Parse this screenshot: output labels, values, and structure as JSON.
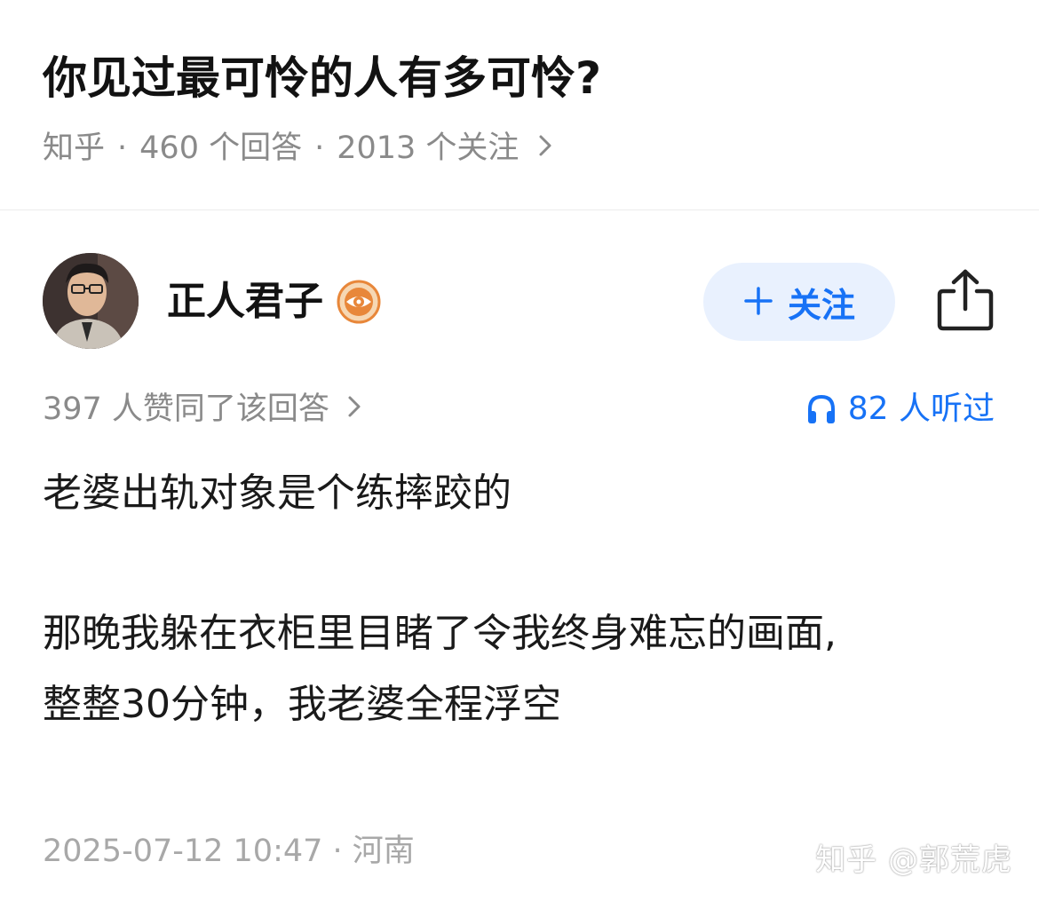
{
  "question": {
    "title": "你见过最可怜的人有多可怜?",
    "source": "知乎",
    "answers_count": "460 个回答",
    "followers_count": "2013 个关注",
    "separator": "·"
  },
  "answer": {
    "author": {
      "name": "正人君子",
      "avatar": "avatar-photo",
      "badge_icon": "eye-badge-icon"
    },
    "follow_button": {
      "icon": "plus-icon",
      "label": "关注"
    },
    "share_icon": "share-icon",
    "upvote_text": "397 人赞同了该回答",
    "listen": {
      "icon": "headphones-icon",
      "text": "82 人听过"
    },
    "paragraphs": [
      "老婆出轨对象是个练摔跤的",
      "那晚我躲在衣柜里目睹了令我终身难忘的画面,",
      "整整30分钟，我老婆全程浮空"
    ],
    "timestamp": "2025-07-12 10:47 · 河南"
  },
  "watermark": "知乎 @郭荒虎",
  "colors": {
    "accent": "#1772f6",
    "follow_bg": "#e9f1fe",
    "meta_text": "#8a8a8a",
    "badge": "#e8873a"
  }
}
